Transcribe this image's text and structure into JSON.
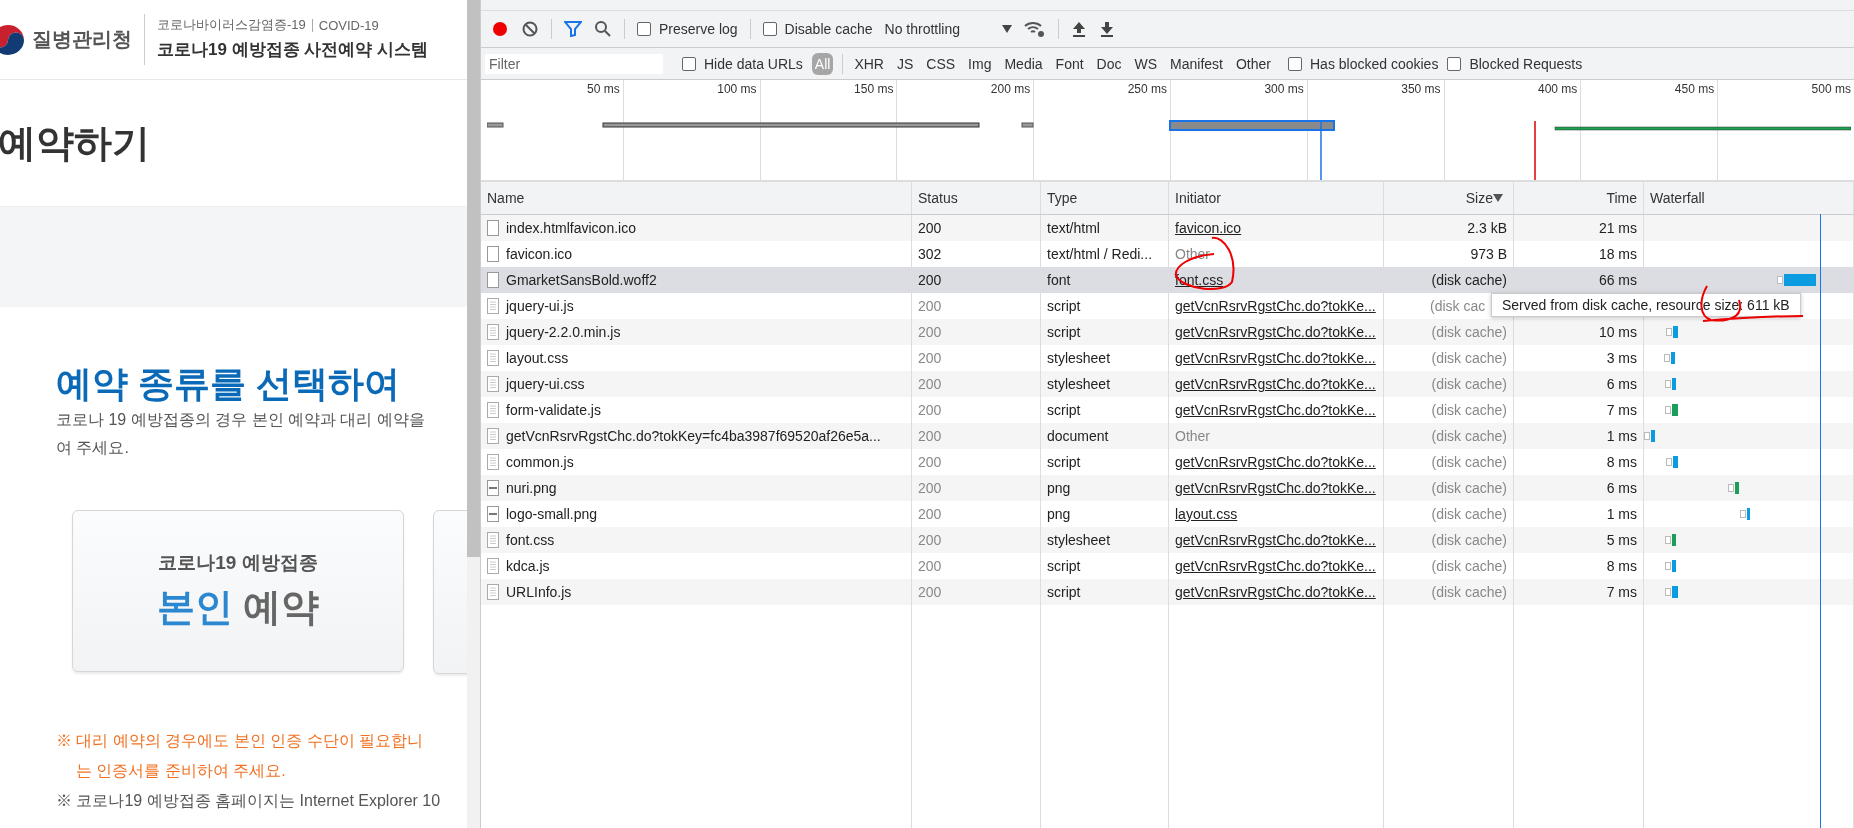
{
  "page": {
    "agency": "질병관리청",
    "subtitle": "코로나바이러스감염증-19",
    "subtitle_en": "COVID-19",
    "system_title": "코로나19 예방접종 사전예약 시스템",
    "page_title": "예약하기",
    "heading": "예약 종류를 선택하여",
    "intro": [
      "코로나 19 예방접종의 경우 본인 예약과 대리 예약을",
      "여 주세요."
    ],
    "card": {
      "label": "코로나19 예방접종",
      "highlight": "본인",
      "rest": "예약"
    },
    "notes": [
      "※ 대리 예약의 경우에도 본인 인증 수단이 필요합니",
      "는 인증서를 준비하여 주세요.",
      "※ 코로나19 예방접종 홈페이지는 Internet Explorer 10"
    ]
  },
  "devtools": {
    "toolbar": {
      "recording": true,
      "preserve_log": {
        "label": "Preserve log",
        "checked": false
      },
      "disable_cache": {
        "label": "Disable cache",
        "checked": false
      },
      "throttling": "No throttling"
    },
    "filter": {
      "placeholder": "Filter",
      "hide_data_urls": {
        "label": "Hide data URLs",
        "checked": false
      },
      "types": [
        {
          "label": "All",
          "selected": true
        },
        {
          "label": "XHR",
          "selected": false
        },
        {
          "label": "JS",
          "selected": false
        },
        {
          "label": "CSS",
          "selected": false
        },
        {
          "label": "Img",
          "selected": false
        },
        {
          "label": "Media",
          "selected": false
        },
        {
          "label": "Font",
          "selected": false
        },
        {
          "label": "Doc",
          "selected": false
        },
        {
          "label": "WS",
          "selected": false
        },
        {
          "label": "Manifest",
          "selected": false
        },
        {
          "label": "Other",
          "selected": false
        }
      ],
      "blocked_cookies": {
        "label": "Has blocked cookies",
        "checked": false
      },
      "blocked_requests": {
        "label": "Blocked Requests",
        "checked": false
      }
    },
    "overview_ticks": [
      "50 ms",
      "100 ms",
      "150 ms",
      "200 ms",
      "250 ms",
      "300 ms",
      "350 ms",
      "400 ms",
      "450 ms",
      "500 ms"
    ],
    "columns": [
      {
        "label": "Name",
        "sorted": false
      },
      {
        "label": "Status",
        "sorted": false
      },
      {
        "label": "Type",
        "sorted": false
      },
      {
        "label": "Initiator",
        "sorted": false
      },
      {
        "label": "Size",
        "sorted": true
      },
      {
        "label": "Time",
        "sorted": false
      },
      {
        "label": "Waterfall",
        "sorted": false
      }
    ],
    "rows": [
      {
        "name": "index.htmlfavicon.ico",
        "kind": "blank",
        "status": "200",
        "type": "text/html",
        "initiator": "favicon.ico",
        "initiator_is_link": true,
        "size": "2.3 kB",
        "cached": false,
        "time": "21 ms",
        "selected": false
      },
      {
        "name": "favicon.ico",
        "kind": "blank",
        "status": "302",
        "type": "text/html / Redi...",
        "initiator": "Other",
        "initiator_is_link": false,
        "size": "973 B",
        "cached": false,
        "time": "18 ms",
        "selected": false
      },
      {
        "name": "GmarketSansBold.woff2",
        "kind": "blank",
        "status": "200",
        "type": "font",
        "initiator": "font.css",
        "initiator_is_link": true,
        "size": "(disk cache)",
        "cached": false,
        "time": "66 ms",
        "selected": true
      },
      {
        "name": "jquery-ui.js",
        "kind": "text",
        "status": "200",
        "type": "script",
        "initiator": "getVcnRsrvRgstChc.do?tokKe...",
        "initiator_is_link": true,
        "size": "(disk cac",
        "cached": true,
        "tooltip": "Served from disk cache, resource size: 611 kB",
        "selected": false
      },
      {
        "name": "jquery-2.2.0.min.js",
        "kind": "text",
        "status": "200",
        "type": "script",
        "initiator": "getVcnRsrvRgstChc.do?tokKe...",
        "initiator_is_link": true,
        "size": "(disk cache)",
        "cached": true,
        "time": "10 ms",
        "selected": false
      },
      {
        "name": "layout.css",
        "kind": "text",
        "status": "200",
        "type": "stylesheet",
        "initiator": "getVcnRsrvRgstChc.do?tokKe...",
        "initiator_is_link": true,
        "size": "(disk cache)",
        "cached": true,
        "time": "3 ms",
        "selected": false
      },
      {
        "name": "jquery-ui.css",
        "kind": "text",
        "status": "200",
        "type": "stylesheet",
        "initiator": "getVcnRsrvRgstChc.do?tokKe...",
        "initiator_is_link": true,
        "size": "(disk cache)",
        "cached": true,
        "time": "6 ms",
        "selected": false
      },
      {
        "name": "form-validate.js",
        "kind": "text",
        "status": "200",
        "type": "script",
        "initiator": "getVcnRsrvRgstChc.do?tokKe...",
        "initiator_is_link": true,
        "size": "(disk cache)",
        "cached": true,
        "time": "7 ms",
        "selected": false
      },
      {
        "name": "getVcnRsrvRgstChc.do?tokKey=fc4ba3987f69520af26e5a...",
        "kind": "text",
        "status": "200",
        "type": "document",
        "initiator": "Other",
        "initiator_is_link": false,
        "size": "(disk cache)",
        "cached": true,
        "time": "1 ms",
        "selected": false
      },
      {
        "name": "common.js",
        "kind": "text",
        "status": "200",
        "type": "script",
        "initiator": "getVcnRsrvRgstChc.do?tokKe...",
        "initiator_is_link": true,
        "size": "(disk cache)",
        "cached": true,
        "time": "8 ms",
        "selected": false
      },
      {
        "name": "nuri.png",
        "kind": "image",
        "status": "200",
        "type": "png",
        "initiator": "getVcnRsrvRgstChc.do?tokKe...",
        "initiator_is_link": true,
        "size": "(disk cache)",
        "cached": true,
        "time": "6 ms",
        "selected": false
      },
      {
        "name": "logo-small.png",
        "kind": "image",
        "status": "200",
        "type": "png",
        "initiator": "layout.css",
        "initiator_is_link": true,
        "size": "(disk cache)",
        "cached": true,
        "time": "1 ms",
        "selected": false
      },
      {
        "name": "font.css",
        "kind": "text",
        "status": "200",
        "type": "stylesheet",
        "initiator": "getVcnRsrvRgstChc.do?tokKe...",
        "initiator_is_link": true,
        "size": "(disk cache)",
        "cached": true,
        "time": "5 ms",
        "selected": false
      },
      {
        "name": "kdca.js",
        "kind": "text",
        "status": "200",
        "type": "script",
        "initiator": "getVcnRsrvRgstChc.do?tokKe...",
        "initiator_is_link": true,
        "size": "(disk cache)",
        "cached": true,
        "time": "8 ms",
        "selected": false
      },
      {
        "name": "URLInfo.js",
        "kind": "text",
        "status": "200",
        "type": "script",
        "initiator": "getVcnRsrvRgstChc.do?tokKe...",
        "initiator_is_link": true,
        "size": "(disk cache)",
        "cached": true,
        "time": "7 ms",
        "selected": false
      }
    ]
  }
}
